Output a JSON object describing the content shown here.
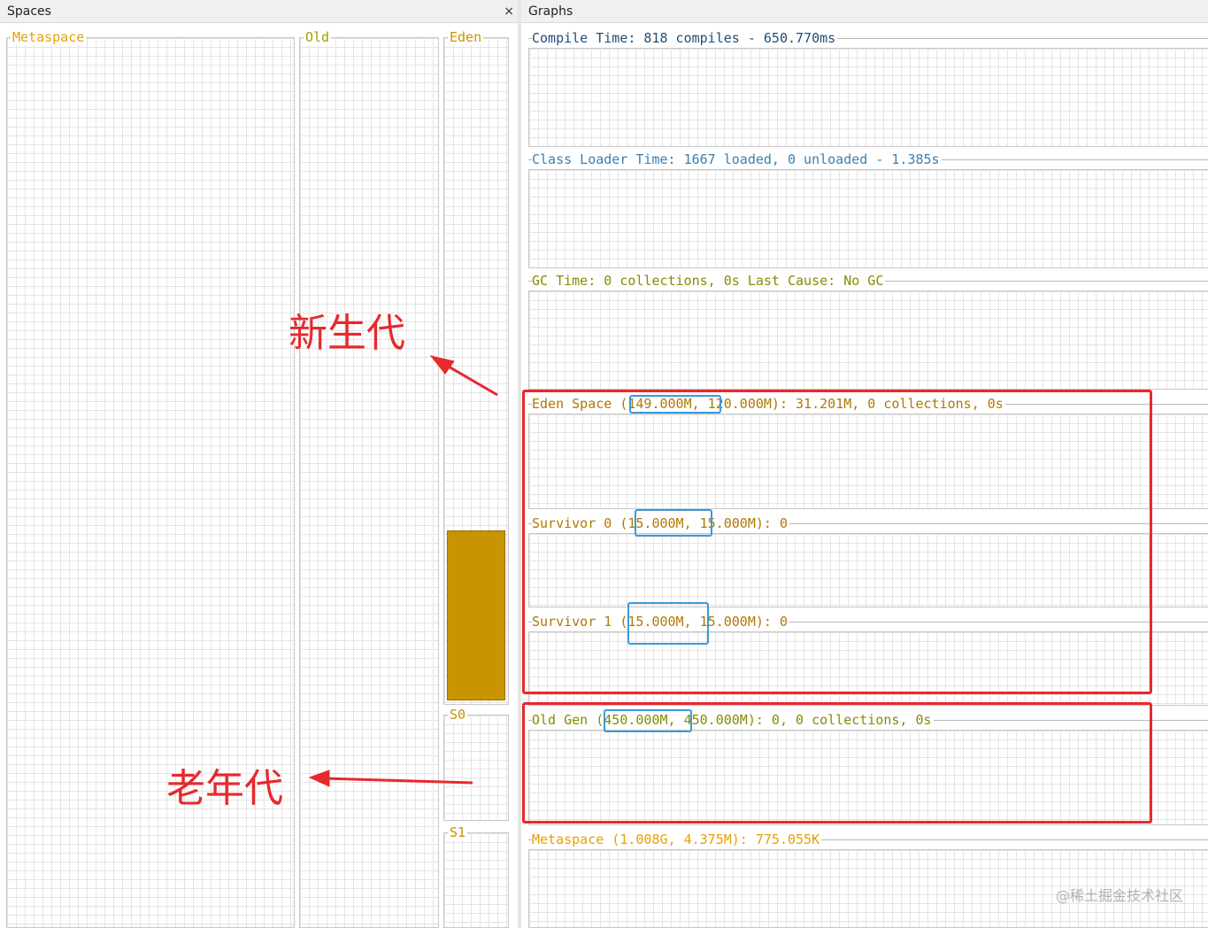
{
  "spaces": {
    "header": "Spaces",
    "close": "×",
    "metaspace": {
      "title": "Metaspace",
      "color": "#e8a000"
    },
    "old": {
      "title": "Old",
      "color": "#a0a000"
    },
    "eden": {
      "title": "Eden",
      "color": "#c89400",
      "fill_fraction": 0.26
    },
    "s0": {
      "title": "S0",
      "color": "#c89400"
    },
    "s1": {
      "title": "S1",
      "color": "#c89400"
    }
  },
  "graphs": {
    "header": "Graphs",
    "compile_time": "Compile Time: 818 compiles - 650.770ms",
    "class_loader_time": "Class Loader Time: 1667 loaded, 0 unloaded - 1.385s",
    "gc_time": "GC Time: 0 collections, 0s Last Cause: No GC",
    "eden_space": "Eden Space (149.000M, 120.000M): 31.201M, 0 collections, 0s",
    "survivor0": "Survivor 0 (15.000M, 15.000M): 0",
    "survivor1": "Survivor 1 (15.000M, 15.000M): 0",
    "old_gen": "Old Gen (450.000M, 450.000M): 0, 0 collections, 0s",
    "metaspace": "Metaspace (1.008G, 4.375M): 775.055K"
  },
  "annotations": {
    "young_gen": "新生代",
    "old_gen": "老年代"
  },
  "watermark": "@稀土掘金技术社区",
  "colors": {
    "compile": "#1f4e79",
    "classloader": "#3a7fb0",
    "gc": "#8a8a00",
    "eden": "#b07800",
    "old": "#8a8a00",
    "meta": "#e8a000",
    "annotation": "#e8282d",
    "highlight": "#3b9ad8"
  }
}
